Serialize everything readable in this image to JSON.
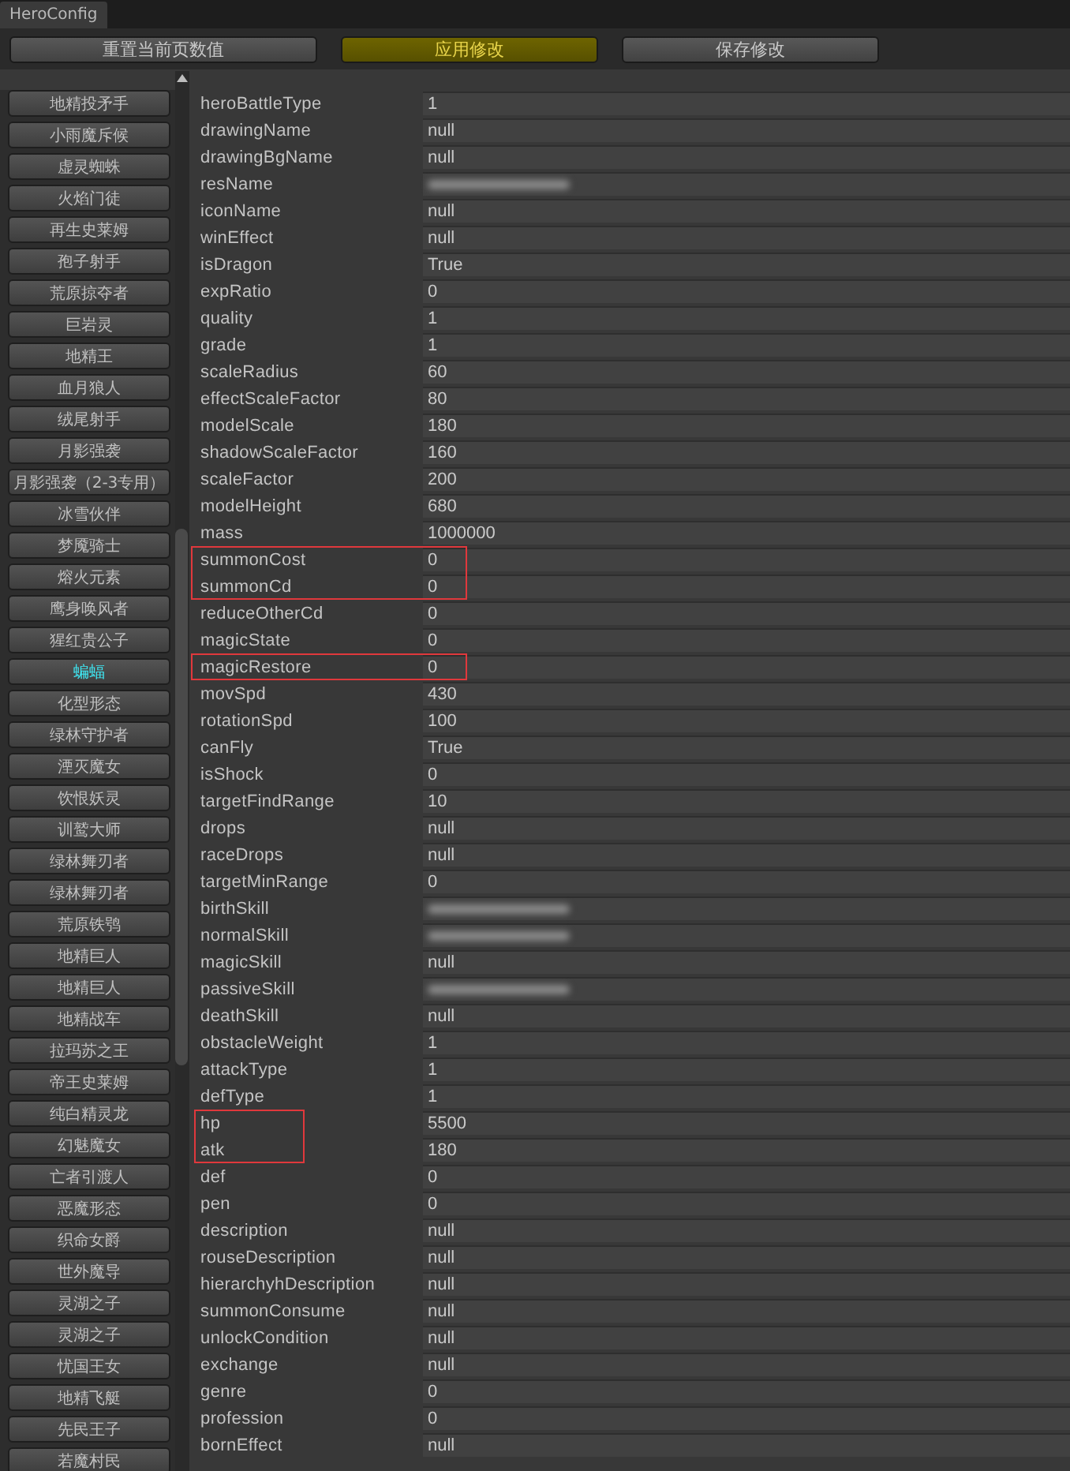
{
  "window": {
    "tab": "HeroConfig"
  },
  "toolbar": [
    {
      "label": "重置当前页数值",
      "highlighted": false
    },
    {
      "label": "应用修改",
      "highlighted": true
    },
    {
      "label": "保存修改",
      "highlighted": false
    }
  ],
  "hero_list": [
    {
      "label": "地精投矛手",
      "selected": false
    },
    {
      "label": "小雨魔斥候",
      "selected": false
    },
    {
      "label": "虚灵蜘蛛",
      "selected": false
    },
    {
      "label": "火焰门徒",
      "selected": false
    },
    {
      "label": "再生史莱姆",
      "selected": false
    },
    {
      "label": "孢子射手",
      "selected": false
    },
    {
      "label": "荒原掠夺者",
      "selected": false
    },
    {
      "label": "巨岩灵",
      "selected": false
    },
    {
      "label": "地精王",
      "selected": false
    },
    {
      "label": "血月狼人",
      "selected": false
    },
    {
      "label": "绒尾射手",
      "selected": false
    },
    {
      "label": "月影强袭",
      "selected": false
    },
    {
      "label": "月影强袭（2-3专用）",
      "selected": false
    },
    {
      "label": "冰雪伙伴",
      "selected": false
    },
    {
      "label": "梦魇骑士",
      "selected": false
    },
    {
      "label": "熔火元素",
      "selected": false
    },
    {
      "label": "鹰身唤风者",
      "selected": false
    },
    {
      "label": "猩红贵公子",
      "selected": false
    },
    {
      "label": "蝙蝠",
      "selected": true
    },
    {
      "label": "化型形态",
      "selected": false
    },
    {
      "label": "绿林守护者",
      "selected": false
    },
    {
      "label": "湮灭魔女",
      "selected": false
    },
    {
      "label": "饮恨妖灵",
      "selected": false
    },
    {
      "label": "训鹫大师",
      "selected": false
    },
    {
      "label": "绿林舞刃者",
      "selected": false
    },
    {
      "label": "绿林舞刃者",
      "selected": false
    },
    {
      "label": "荒原铁鸮",
      "selected": false
    },
    {
      "label": "地精巨人",
      "selected": false
    },
    {
      "label": "地精巨人",
      "selected": false
    },
    {
      "label": "地精战车",
      "selected": false
    },
    {
      "label": "拉玛苏之王",
      "selected": false
    },
    {
      "label": "帝王史莱姆",
      "selected": false
    },
    {
      "label": "纯白精灵龙",
      "selected": false
    },
    {
      "label": "幻魅魔女",
      "selected": false
    },
    {
      "label": "亡者引渡人",
      "selected": false
    },
    {
      "label": "恶魔形态",
      "selected": false
    },
    {
      "label": "织命女爵",
      "selected": false
    },
    {
      "label": "世外魔导",
      "selected": false
    },
    {
      "label": "灵湖之子",
      "selected": false
    },
    {
      "label": "灵湖之子",
      "selected": false
    },
    {
      "label": "忧国王女",
      "selected": false
    },
    {
      "label": "地精飞艇",
      "selected": false
    },
    {
      "label": "先民王子",
      "selected": false
    },
    {
      "label": "若魔村民",
      "selected": false
    }
  ],
  "property_groups": [
    {
      "outlined": false,
      "rows": [
        {
          "name": "heroBattleType",
          "kind": "text",
          "value": "1"
        },
        {
          "name": "drawingName",
          "kind": "text",
          "value": "null"
        },
        {
          "name": "drawingBgName",
          "kind": "text",
          "value": "null"
        },
        {
          "name": "resName",
          "kind": "redacted"
        },
        {
          "name": "iconName",
          "kind": "text",
          "value": "null"
        },
        {
          "name": "winEffect",
          "kind": "text",
          "value": "null"
        },
        {
          "name": "isDragon",
          "kind": "text",
          "value": "True"
        },
        {
          "name": "expRatio",
          "kind": "text",
          "value": "0"
        },
        {
          "name": "quality",
          "kind": "text",
          "value": "1"
        },
        {
          "name": "grade",
          "kind": "text",
          "value": "1"
        },
        {
          "name": "scaleRadius",
          "kind": "text",
          "value": "60"
        },
        {
          "name": "effectScaleFactor",
          "kind": "text",
          "value": "80"
        },
        {
          "name": "modelScale",
          "kind": "text",
          "value": "180"
        },
        {
          "name": "shadowScaleFactor",
          "kind": "text",
          "value": "160"
        },
        {
          "name": "scaleFactor",
          "kind": "text",
          "value": "200"
        },
        {
          "name": "modelHeight",
          "kind": "text",
          "value": "680"
        },
        {
          "name": "mass",
          "kind": "text",
          "value": "1000000"
        }
      ]
    },
    {
      "outlined": true,
      "value_outlined": true,
      "rows": [
        {
          "name": "summonCost",
          "kind": "text",
          "value": "0"
        },
        {
          "name": "summonCd",
          "kind": "text",
          "value": "0"
        }
      ]
    },
    {
      "outlined": false,
      "rows": [
        {
          "name": "reduceOtherCd",
          "kind": "text",
          "value": "0"
        },
        {
          "name": "magicState",
          "kind": "text",
          "value": "0"
        }
      ]
    },
    {
      "outlined": true,
      "value_outlined": true,
      "rows": [
        {
          "name": "magicRestore",
          "kind": "text",
          "value": "0"
        }
      ]
    },
    {
      "outlined": false,
      "rows": [
        {
          "name": "movSpd",
          "kind": "text",
          "value": "430"
        },
        {
          "name": "rotationSpd",
          "kind": "text",
          "value": "100"
        },
        {
          "name": "canFly",
          "kind": "text",
          "value": "True"
        },
        {
          "name": "isShock",
          "kind": "text",
          "value": "0"
        },
        {
          "name": "targetFindRange",
          "kind": "text",
          "value": "10"
        },
        {
          "name": "drops",
          "kind": "text",
          "value": "null"
        },
        {
          "name": "raceDrops",
          "kind": "text",
          "value": "null"
        },
        {
          "name": "targetMinRange",
          "kind": "text",
          "value": "0"
        },
        {
          "name": "birthSkill",
          "kind": "redacted"
        },
        {
          "name": "normalSkill",
          "kind": "redacted"
        },
        {
          "name": "magicSkill",
          "kind": "text",
          "value": "null"
        },
        {
          "name": "passiveSkill",
          "kind": "redacted"
        },
        {
          "name": "deathSkill",
          "kind": "text",
          "value": "null"
        },
        {
          "name": "obstacleWeight",
          "kind": "text",
          "value": "1"
        },
        {
          "name": "attackType",
          "kind": "text",
          "value": "1"
        },
        {
          "name": "defType",
          "kind": "text",
          "value": "1"
        }
      ]
    },
    {
      "outlined": true,
      "value_outlined": false,
      "rows": [
        {
          "name": "hp",
          "kind": "text",
          "value": "5500"
        },
        {
          "name": "atk",
          "kind": "text",
          "value": "180"
        }
      ]
    },
    {
      "outlined": false,
      "rows": [
        {
          "name": "def",
          "kind": "text",
          "value": "0"
        },
        {
          "name": "pen",
          "kind": "text",
          "value": "0"
        },
        {
          "name": "description",
          "kind": "text",
          "value": "null"
        },
        {
          "name": "rouseDescription",
          "kind": "text",
          "value": "null"
        },
        {
          "name": "hierarchyhDescription",
          "kind": "text",
          "value": "null"
        },
        {
          "name": "summonConsume",
          "kind": "text",
          "value": "null"
        },
        {
          "name": "unlockCondition",
          "kind": "text",
          "value": "null"
        },
        {
          "name": "exchange",
          "kind": "text",
          "value": "null"
        },
        {
          "name": "genre",
          "kind": "text",
          "value": "0"
        },
        {
          "name": "profession",
          "kind": "text",
          "value": "0"
        },
        {
          "name": "bornEffect",
          "kind": "text",
          "value": "null"
        }
      ]
    }
  ]
}
